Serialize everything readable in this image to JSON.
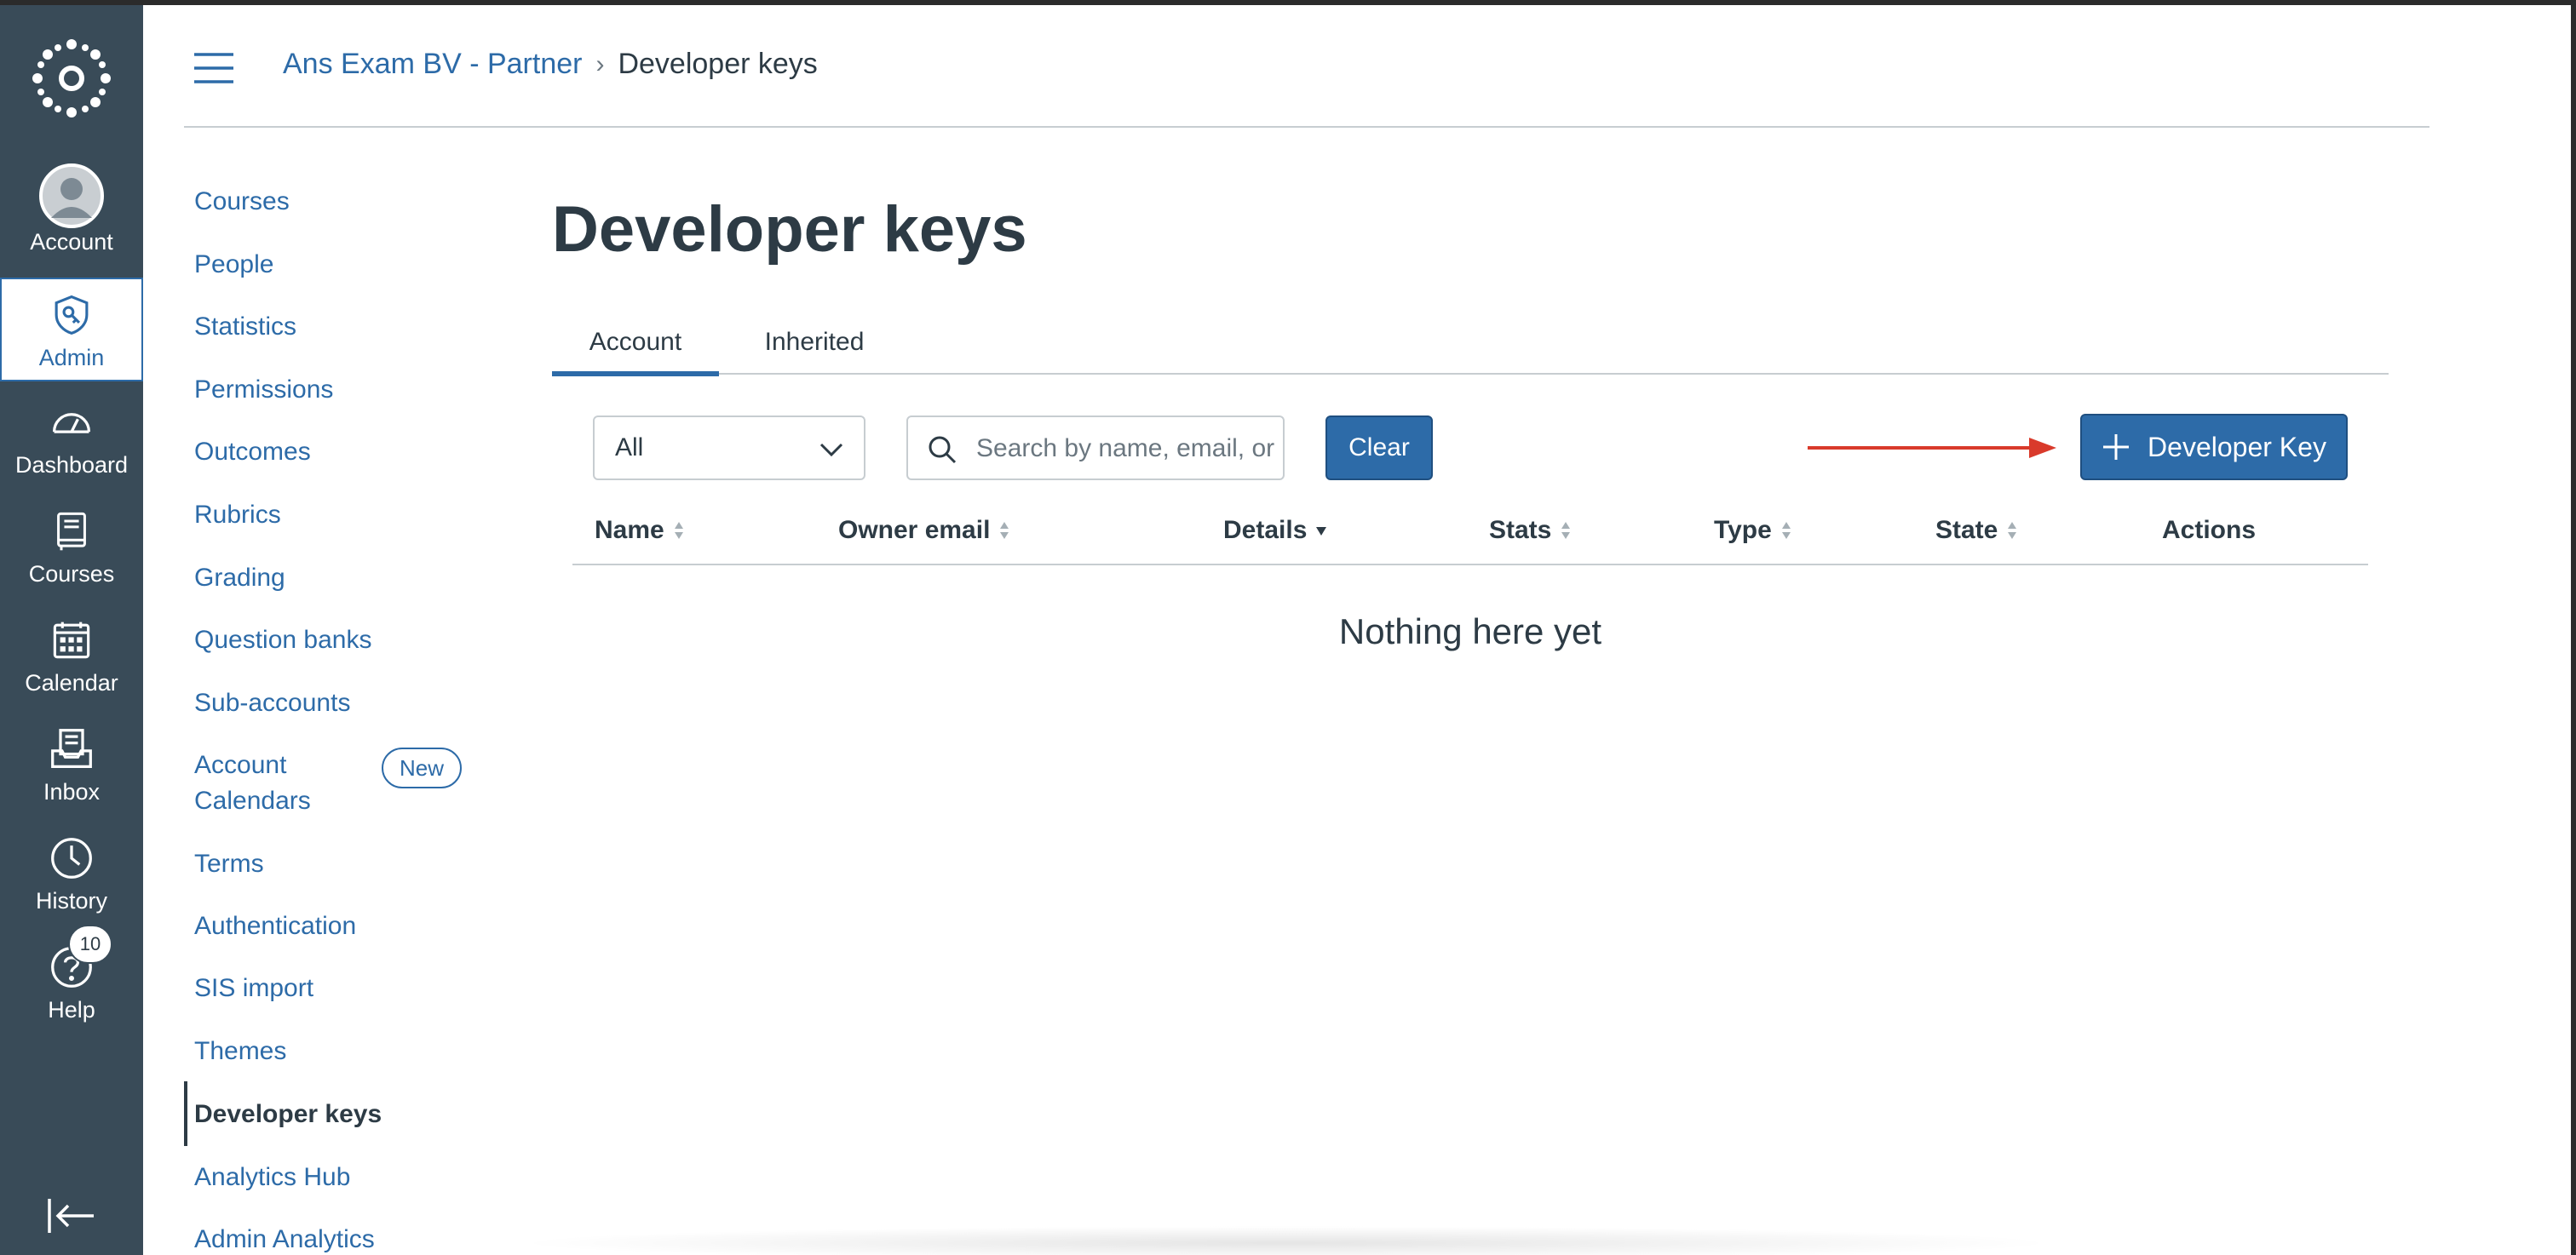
{
  "global_nav": {
    "items": [
      {
        "key": "account",
        "label": "Account"
      },
      {
        "key": "admin",
        "label": "Admin"
      },
      {
        "key": "dashboard",
        "label": "Dashboard"
      },
      {
        "key": "courses",
        "label": "Courses"
      },
      {
        "key": "calendar",
        "label": "Calendar"
      },
      {
        "key": "inbox",
        "label": "Inbox"
      },
      {
        "key": "history",
        "label": "History"
      },
      {
        "key": "help",
        "label": "Help"
      }
    ],
    "active": "Admin",
    "help_badge": "10"
  },
  "breadcrumb": {
    "account": "Ans Exam BV - Partner",
    "current": "Developer keys"
  },
  "subnav": {
    "items": [
      "Courses",
      "People",
      "Statistics",
      "Permissions",
      "Outcomes",
      "Rubrics",
      "Grading",
      "Question banks",
      "Sub-accounts",
      "Account Calendars",
      "Terms",
      "Authentication",
      "SIS import",
      "Themes",
      "Developer keys",
      "Analytics Hub",
      "Admin Analytics"
    ],
    "account_calendars_line1": "Account",
    "account_calendars_line2": "Calendars",
    "new_badge": "New",
    "active": "Developer keys"
  },
  "main": {
    "title": "Developer keys",
    "tabs": [
      {
        "label": "Account",
        "active": true
      },
      {
        "label": "Inherited",
        "active": false
      }
    ],
    "filter": {
      "selected": "All"
    },
    "search": {
      "placeholder": "Search by name, email, or ID",
      "value": ""
    },
    "clear_label": "Clear",
    "add_key_label": "Developer Key",
    "table": {
      "columns": [
        "Name",
        "Owner email",
        "Details",
        "Stats",
        "Type",
        "State",
        "Actions"
      ],
      "rows": [],
      "empty_message": "Nothing here yet"
    }
  },
  "colors": {
    "nav_bg": "#394b58",
    "accent": "#2d6ba8",
    "annotation_arrow": "#d93a2b"
  }
}
